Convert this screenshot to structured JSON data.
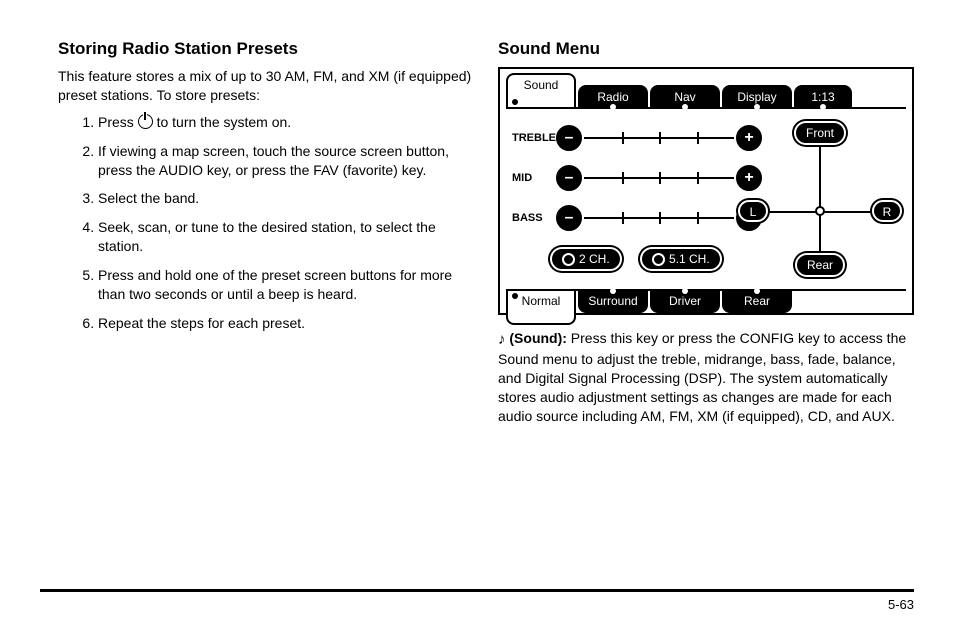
{
  "left": {
    "heading": "Storing Radio Station Presets",
    "intro": "This feature stores a mix of up to 30 AM, FM, and XM (if equipped) preset stations. To store presets:",
    "steps": [
      "to turn the system on.",
      "If viewing a map screen, touch the source screen button, press the AUDIO key, or press the FAV (favorite) key.",
      "Select the band.",
      "Seek, scan, or tune to the desired station, to select the station.",
      "Press and hold one of the preset screen buttons for more than two seconds or until a beep is heard.",
      "Repeat the steps for each preset."
    ],
    "step1_prefix": "Press "
  },
  "right": {
    "heading": "Sound Menu",
    "tabs_top": {
      "sound": "Sound",
      "radio": "Radio",
      "nav": "Nav",
      "display": "Display",
      "clock": "1:13"
    },
    "sliders": {
      "treble": "TREBLE",
      "mid": "MID",
      "bass": "BASS",
      "minus": "–",
      "plus": "+"
    },
    "buttons": {
      "ch2": "2 CH.",
      "ch51": "5.1 CH.",
      "front": "Front",
      "rear": "Rear",
      "L": "L",
      "R": "R"
    },
    "tabs_bottom": {
      "normal": "Normal",
      "surround": "Surround",
      "driver": "Driver",
      "rear": "Rear"
    },
    "sound_caption_label": "(Sound):",
    "sound_caption_body": " Press this key or press the CONFIG key to access the Sound menu to adjust the treble, midrange, bass, fade, balance, and Digital Signal Processing (DSP). The system automatically stores audio adjustment settings as changes are made for each audio source including AM, FM, XM (if equipped), CD, and AUX."
  },
  "page_number": "5-63"
}
